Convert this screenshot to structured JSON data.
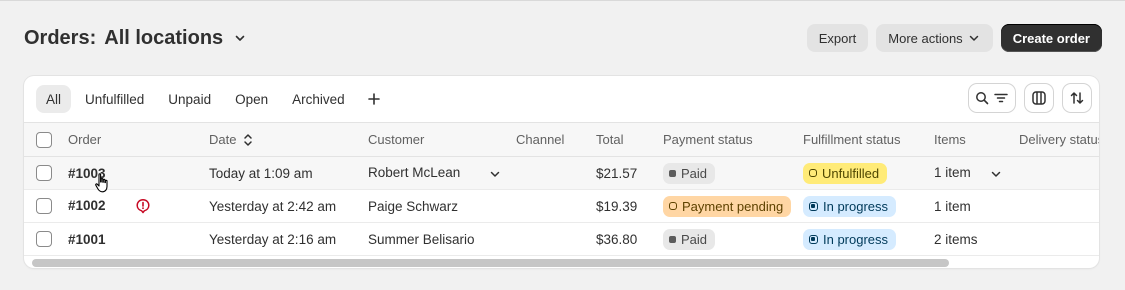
{
  "header": {
    "title": "Orders:",
    "location": "All locations",
    "export_label": "Export",
    "more_actions_label": "More actions",
    "create_order_label": "Create order"
  },
  "tabs": [
    {
      "label": "All",
      "active": true
    },
    {
      "label": "Unfulfilled"
    },
    {
      "label": "Unpaid"
    },
    {
      "label": "Open"
    },
    {
      "label": "Archived"
    }
  ],
  "columns": {
    "order": "Order",
    "date": "Date",
    "customer": "Customer",
    "channel": "Channel",
    "total": "Total",
    "payment_status": "Payment status",
    "fulfillment_status": "Fulfillment status",
    "items": "Items",
    "delivery_status": "Delivery status"
  },
  "rows": [
    {
      "order": "#1003",
      "date": "Today at 1:09 am",
      "customer": "Robert McLean",
      "channel": "",
      "total": "$21.57",
      "payment": "Paid",
      "fulfillment": "Unfulfilled",
      "items": "1 item"
    },
    {
      "order": "#1002",
      "date": "Yesterday at 2:42 am",
      "customer": "Paige Schwarz",
      "channel": "",
      "total": "$19.39",
      "payment": "Payment pending",
      "fulfillment": "In progress",
      "items": "1 item"
    },
    {
      "order": "#1001",
      "date": "Yesterday at 2:16 am",
      "customer": "Summer Belisario",
      "channel": "",
      "total": "$36.80",
      "payment": "Paid",
      "fulfillment": "In progress",
      "items": "2 items"
    }
  ],
  "colors": {
    "primary_button": "#303030",
    "paid_badge": "#e8e8e8",
    "unfulfilled_badge": "#ffeb78",
    "pending_badge": "#ffd6a4",
    "in_progress_badge": "#d5ebff",
    "risk_icon": "#c70a24"
  }
}
